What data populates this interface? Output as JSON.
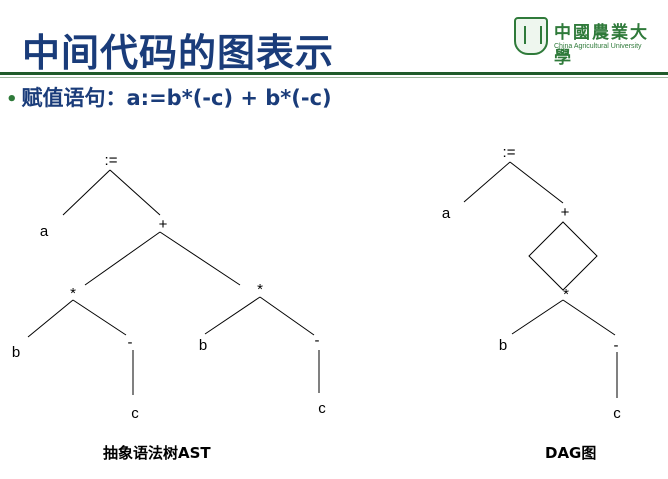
{
  "header": {
    "title": "中间代码的图表示",
    "logo": {
      "name_cn": "中國農業大學",
      "name_en": "China Agricultural University",
      "accent_color": "#2f7a3a"
    }
  },
  "bullet": {
    "label": "赋值语句：",
    "expression": "a:=b*(-c) + b*(-c)"
  },
  "ast": {
    "caption": "抽象语法树AST",
    "nodes": {
      "root": ":=",
      "a": "a",
      "plus": "+",
      "mul_left": "*",
      "mul_right": "*",
      "b_left": "b",
      "neg_left": "-",
      "c_left": "c",
      "b_right": "b",
      "neg_right": "-",
      "c_right": "c"
    }
  },
  "dag": {
    "caption": "DAG图",
    "nodes": {
      "root": ":=",
      "a": "a",
      "plus": "+",
      "mul": "*",
      "b": "b",
      "neg": "-",
      "c": "c"
    }
  },
  "colors": {
    "title": "#1a3c7a",
    "rule": "#1f5b2a"
  }
}
